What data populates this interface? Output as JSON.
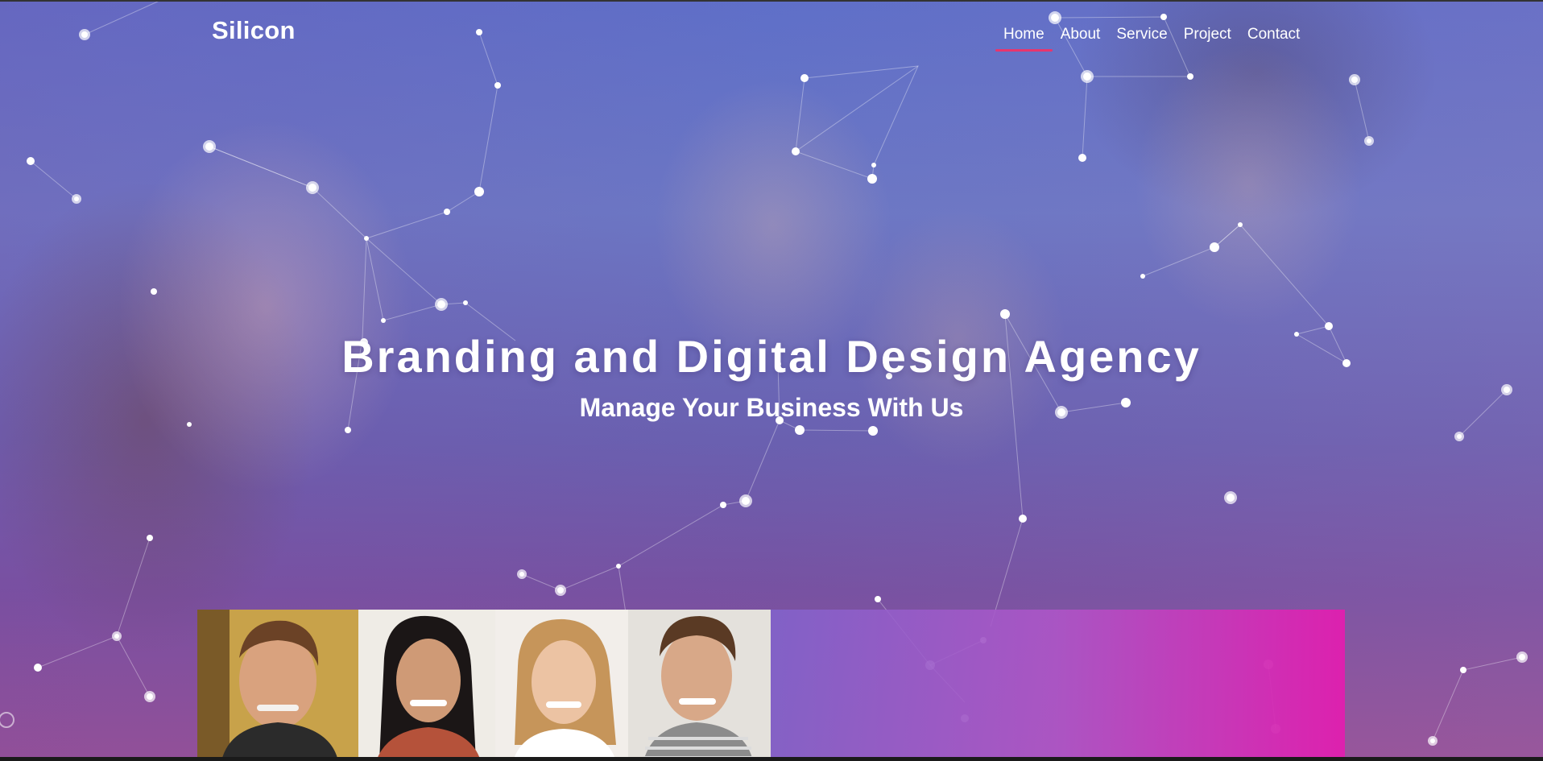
{
  "header": {
    "logo": "Silicon",
    "nav": [
      {
        "label": "Home",
        "active": true
      },
      {
        "label": "About",
        "active": false
      },
      {
        "label": "Service",
        "active": false
      },
      {
        "label": "Project",
        "active": false
      },
      {
        "label": "Contact",
        "active": false
      }
    ]
  },
  "hero": {
    "title": "Branding and Digital Design Agency",
    "subtitle": "Manage Your Business With Us"
  },
  "colors": {
    "accent": "#e8356d",
    "overlay_start": "#5f6fc8",
    "overlay_end": "#9a4f93",
    "panel_pink": "#e11eaf"
  },
  "icons": {
    "network": "particle-network-icon",
    "corner": "circle-outline-icon"
  }
}
